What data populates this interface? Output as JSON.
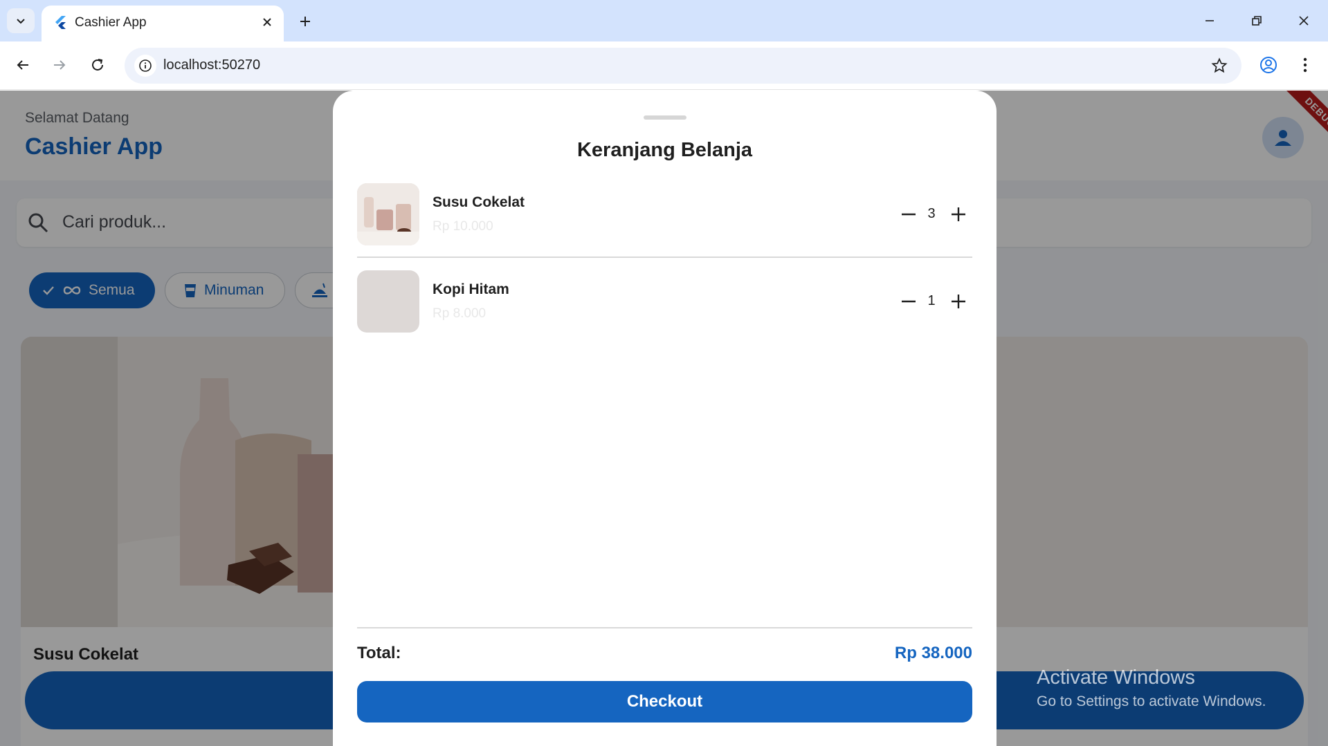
{
  "browser": {
    "tab_title": "Cashier App",
    "url": "localhost:50270"
  },
  "app": {
    "welcome_text": "Selamat Datang",
    "title": "Cashier App",
    "debug_banner": "DEBUG",
    "search_placeholder": "Cari produk...",
    "categories": [
      {
        "label": "Semua",
        "selected": true,
        "icon": "all-inclusive-icon"
      },
      {
        "label": "Minuman",
        "selected": false,
        "icon": "cup-icon"
      },
      {
        "label": "",
        "selected": false,
        "icon": "food-icon"
      }
    ],
    "product_card": {
      "name": "Susu Cokelat"
    }
  },
  "cart": {
    "title": "Keranjang Belanja",
    "items": [
      {
        "name": "Susu Cokelat",
        "price": "Rp 10.000",
        "quantity": "3"
      },
      {
        "name": "Kopi Hitam",
        "price": "Rp 8.000",
        "quantity": "1"
      }
    ],
    "total_label": "Total:",
    "total_value": "Rp 38.000",
    "checkout_label": "Checkout"
  },
  "watermark": {
    "title": "Activate Windows",
    "subtitle": "Go to Settings to activate Windows."
  },
  "colors": {
    "primary": "#1565c0",
    "tabbar": "#d3e3fd",
    "debug": "#b71c1c"
  }
}
